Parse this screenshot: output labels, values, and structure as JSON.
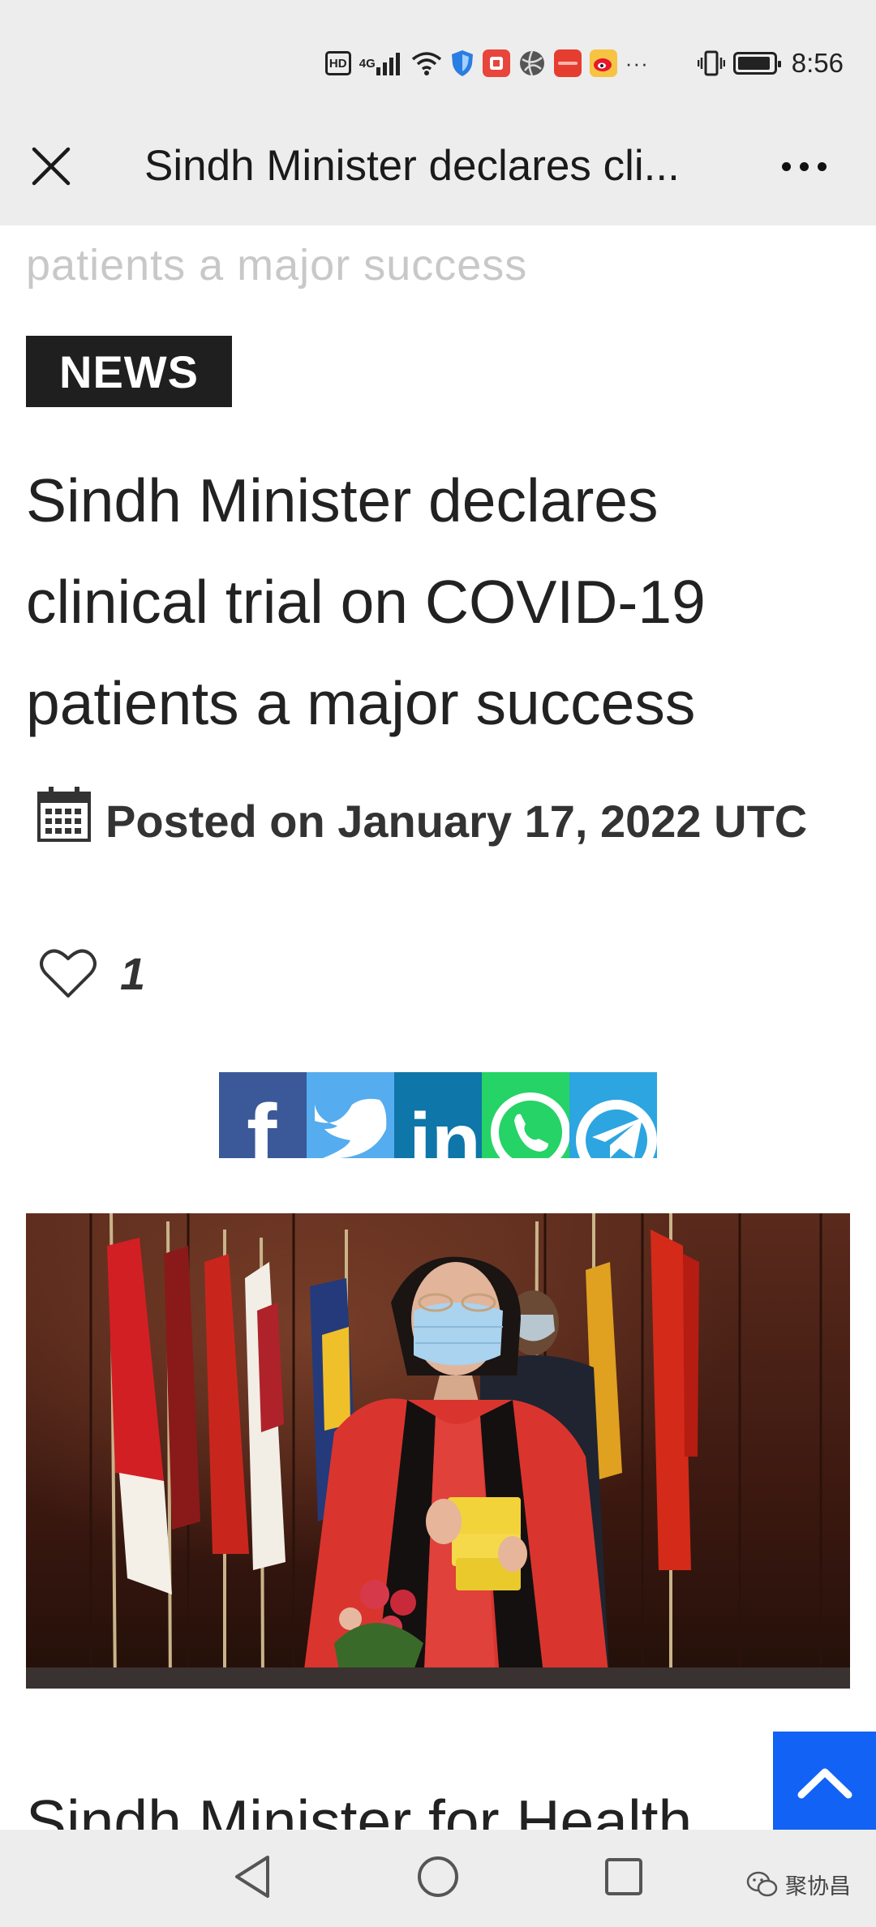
{
  "status_bar": {
    "network_label": "HD",
    "signal_label": "4G",
    "time": "8:56",
    "icons": [
      "hd-icon",
      "signal-icon",
      "wifi-icon",
      "shield-app-icon",
      "red-app-icon",
      "globe-app-icon",
      "red-square-app-icon",
      "weibo-app-icon",
      "more-notifications-icon",
      "vibrate-icon",
      "battery-icon"
    ],
    "more_notifications": "···"
  },
  "title_bar": {
    "title": "Sindh Minister declares cli...",
    "close_icon": "close-icon",
    "more_icon": "more-dots-icon"
  },
  "article": {
    "faded_title": "patients a major success",
    "category_badge": "NEWS",
    "headline": "Sindh Minister declares clinical trial on COVID-19 patients a major success",
    "posted": "Posted on January 17, 2022 UTC",
    "calendar_icon": "calendar-icon",
    "like_icon": "heart-icon",
    "like_count": "1",
    "share_buttons": [
      {
        "name": "facebook",
        "glyph": "f",
        "icon": "facebook-icon"
      },
      {
        "name": "twitter",
        "glyph": "t",
        "icon": "twitter-icon"
      },
      {
        "name": "linkedin",
        "glyph": "in",
        "icon": "linkedin-icon"
      },
      {
        "name": "whatsapp",
        "glyph": "w",
        "icon": "whatsapp-icon"
      },
      {
        "name": "telegram",
        "glyph": "t",
        "icon": "telegram-icon"
      }
    ],
    "photo": "masked-woman-holding-medicine-boxes-with-flags",
    "body_start": "Sindh Minister for Health"
  },
  "back_to_top_icon": "chevron-up-icon",
  "nav_bar": {
    "back_icon": "back-triangle-icon",
    "home_icon": "home-circle-icon",
    "recents_icon": "recents-square-icon",
    "watermark": "聚协昌"
  },
  "colors": {
    "share_facebook": "#3b5998",
    "share_twitter": "#55acee",
    "share_linkedin": "#0e76a8",
    "share_whatsapp": "#25d366",
    "share_telegram": "#2ca5e0",
    "back_to_top": "#1162f5"
  }
}
